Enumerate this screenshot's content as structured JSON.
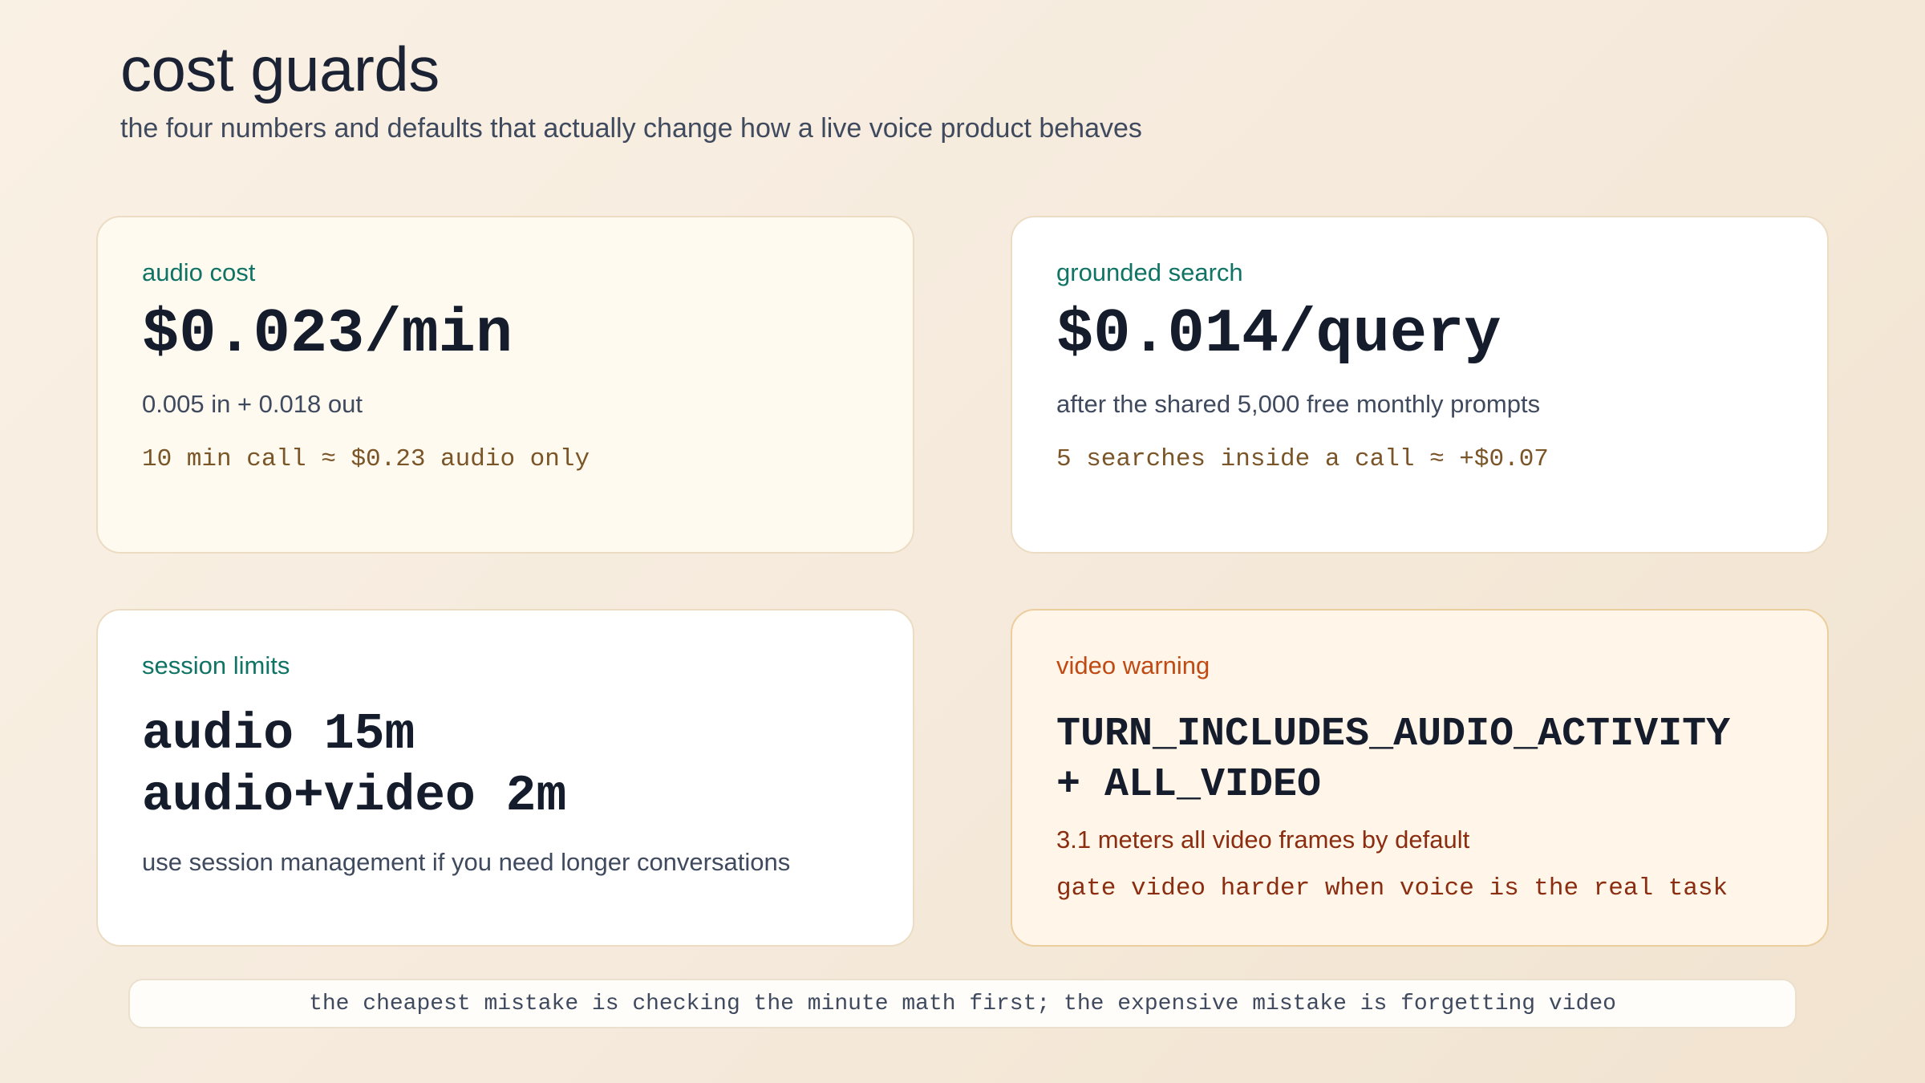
{
  "header": {
    "title": "cost guards",
    "subtitle": "the four numbers and defaults that actually change how a live voice product behaves"
  },
  "cards": {
    "audio_cost": {
      "label": "audio cost",
      "value": "$0.023/min",
      "description": "0.005 in + 0.018 out",
      "note": "10 min call ≈ $0.23 audio only"
    },
    "grounded_search": {
      "label": "grounded search",
      "value": "$0.014/query",
      "description": "after the shared 5,000 free monthly prompts",
      "note": "5 searches inside a call ≈ +$0.07"
    },
    "session_limits": {
      "label": "session limits",
      "value_lines": [
        "audio 15m",
        "audio+video 2m"
      ],
      "description": "use session management if you need longer conversations"
    },
    "video_warning": {
      "label": "video warning",
      "value_lines": [
        "TURN_INCLUDES_AUDIO_ACTIVITY",
        "+ ALL_VIDEO"
      ],
      "description": "3.1 meters all video frames by default",
      "note": "gate video harder when voice is the real task"
    }
  },
  "footer": {
    "text": "the cheapest mistake is checking the minute math first; the expensive mistake is forgetting video"
  },
  "colors": {
    "accent_label": "#0f7464",
    "warning_label": "#c04a14",
    "note_text": "#7a5528",
    "warning_text": "#8a2d10"
  }
}
